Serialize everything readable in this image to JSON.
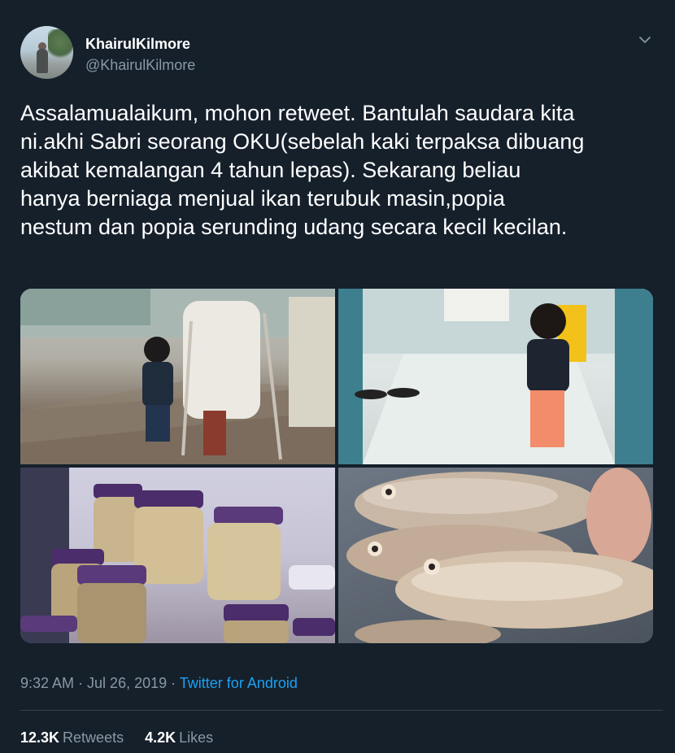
{
  "author": {
    "display_name": "KhairulKilmore",
    "handle": "@KhairulKilmore"
  },
  "tweet": {
    "text": "Assalamualaikum, mohon retweet. Bantulah saudara kita\nni.akhi Sabri seorang OKU(sebelah kaki terpaksa dibuang\nakibat kemalangan 4 tahun lepas). Sekarang beliau\nhanya berniaga menjual ikan terubuk masin,popia\nnestum dan popia serunding udang secara kecil kecilan."
  },
  "meta": {
    "time": "9:32 AM",
    "sep1": " · ",
    "date": "Jul 26, 2019",
    "sep2": " · ",
    "source": "Twitter for Android"
  },
  "stats": {
    "retweets_count": "12.3K",
    "retweets_label": "Retweets",
    "likes_count": "4.2K",
    "likes_label": "Likes"
  },
  "icons": {
    "more": "chevron-down-icon"
  },
  "colors": {
    "background": "#15202b",
    "secondary_text": "#8899a6",
    "link": "#1da1f2"
  }
}
